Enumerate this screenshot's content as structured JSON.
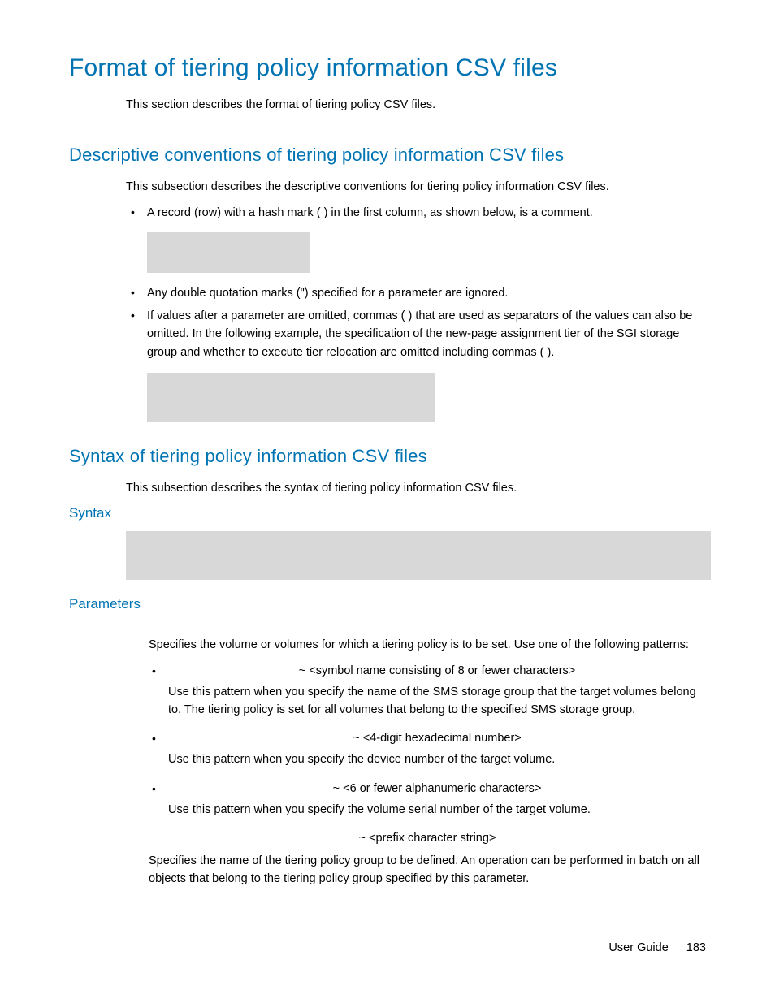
{
  "title": "Format of tiering policy information CSV files",
  "intro": "This section describes the format of tiering policy CSV files.",
  "section1": {
    "heading": "Descriptive conventions of tiering policy information CSV files",
    "intro": "This subsection describes the descriptive conventions for tiering policy information CSV files.",
    "bullets": [
      "A record (row) with a hash mark ( ) in the first column, as shown below, is a comment.",
      "Any double quotation marks (\") specified for a parameter are ignored.",
      "If values after a parameter are omitted, commas ( ) that are used as separators of the values can also be omitted. In the following example, the specification of the new-page assignment tier of the SGI storage group and whether to execute tier relocation are omitted including commas ( )."
    ]
  },
  "section2": {
    "heading": "Syntax of tiering policy information CSV files",
    "intro": "This subsection describes the syntax of tiering policy information CSV files.",
    "syntax_h": "Syntax",
    "params_h": "Parameters",
    "params_intro": "Specifies the volume or volumes for which a tiering policy is to be set. Use one of the following patterns:",
    "patterns": [
      {
        "label": "~ <symbol name consisting of 8 or fewer characters>",
        "desc": "Use this pattern when you specify the name of the SMS storage group that the target volumes belong to. The tiering policy is set for all volumes that belong to the specified SMS storage group."
      },
      {
        "label": "~ <4-digit hexadecimal number>",
        "desc": "Use this pattern when you specify the device number of the target volume."
      },
      {
        "label": "~ <6 or fewer alphanumeric characters>",
        "desc": "Use this pattern when you specify the volume serial number of the target volume."
      }
    ],
    "prefix_label": "~ <prefix character string>",
    "prefix_desc": "Specifies the name of the tiering policy group to be defined. An operation can be performed in batch on all objects that belong to the tiering policy group specified by this parameter."
  },
  "footer": {
    "label": "User Guide",
    "page": "183"
  }
}
